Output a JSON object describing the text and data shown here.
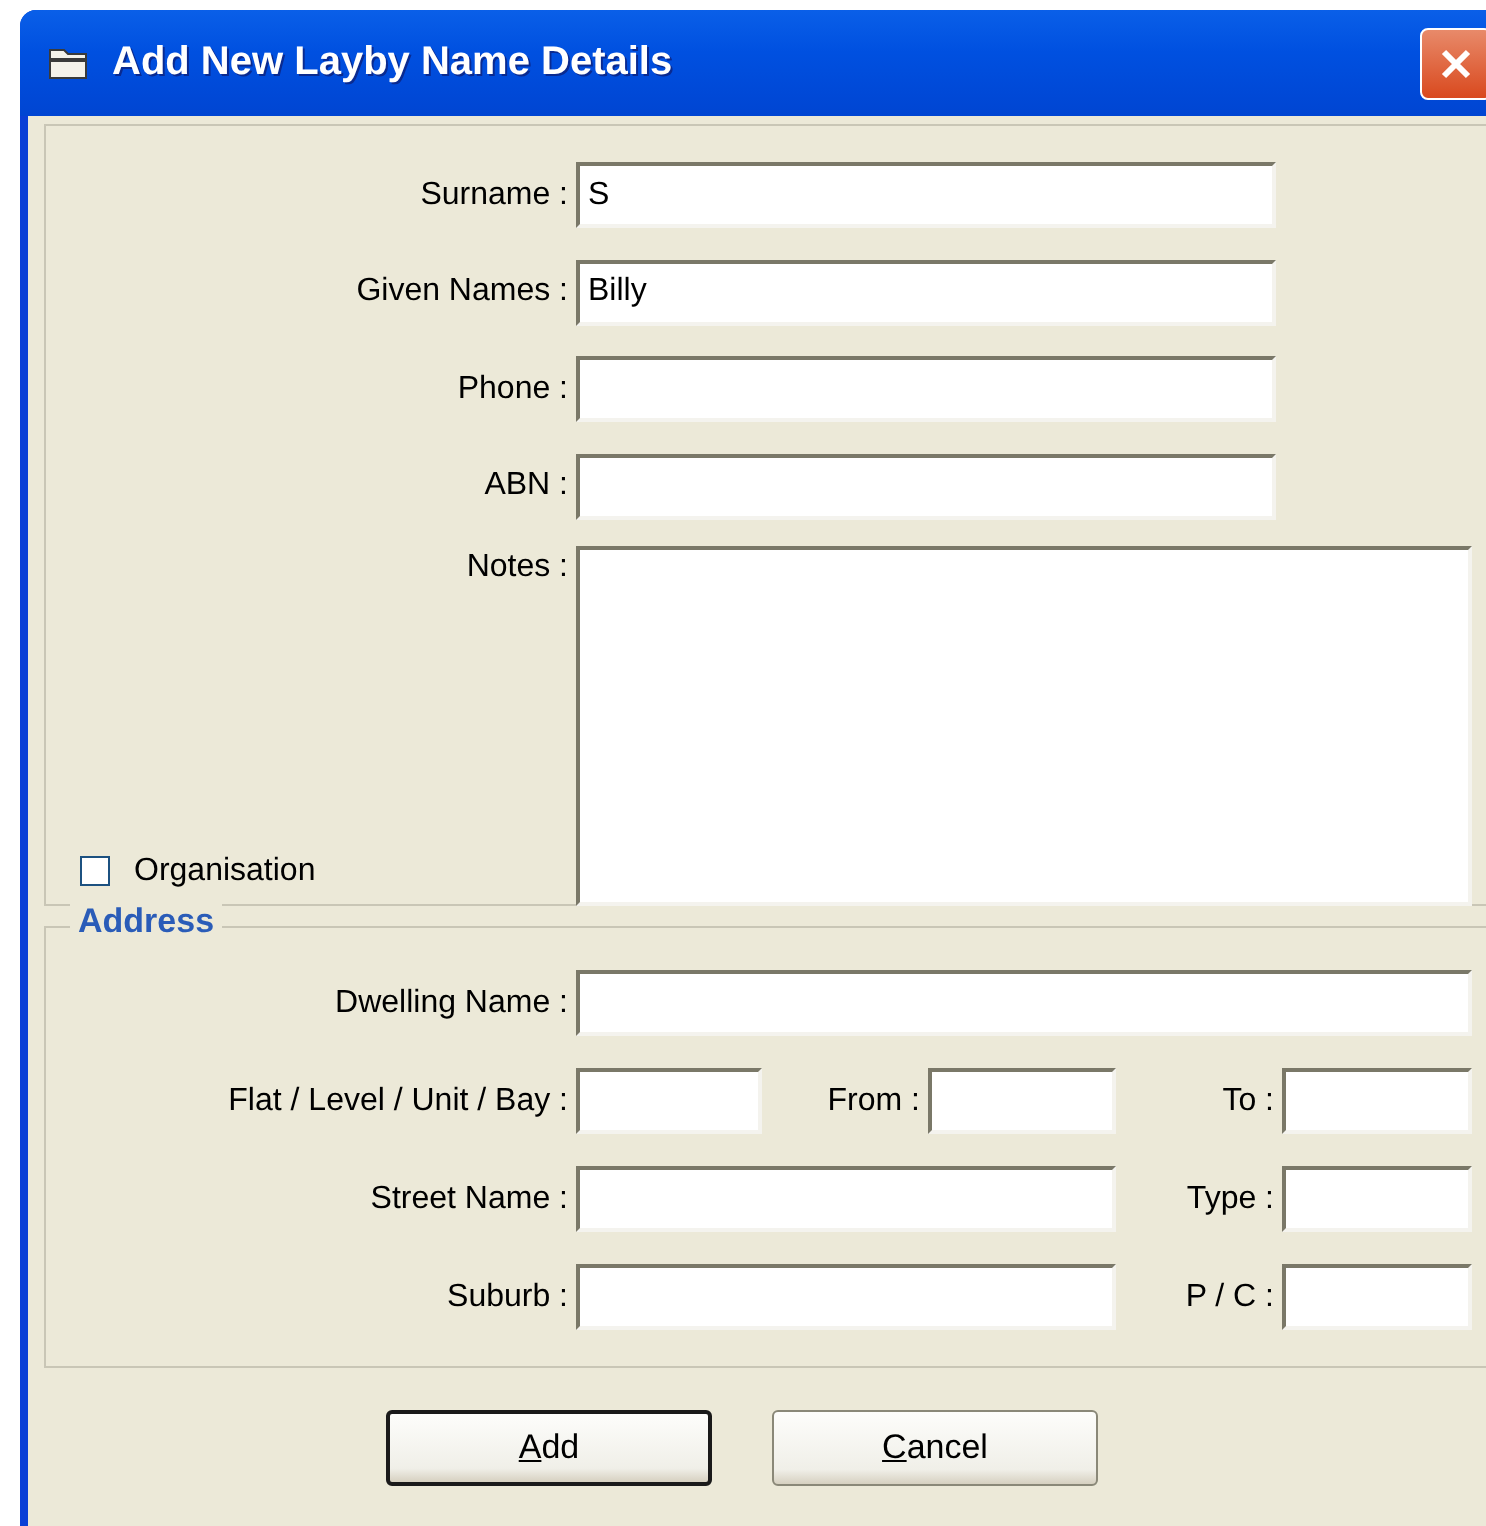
{
  "window": {
    "title": "Add New Layby Name Details"
  },
  "fields": [
    {
      "kind": "text",
      "label": "Surname :",
      "value": "S"
    },
    {
      "kind": "text",
      "label": "Given Names :",
      "value": "Billy"
    },
    {
      "kind": "text",
      "label": "Phone :"
    },
    {
      "kind": "text",
      "label": "ABN :"
    },
    {
      "kind": "notes",
      "label": "Notes :"
    }
  ],
  "organisation": {
    "label": "Organisation",
    "checked": false
  },
  "address": {
    "title": "Address",
    "rows": [
      {
        "fields": [
          {
            "label": "Dwelling Name :"
          }
        ]
      },
      {
        "fields": [
          {
            "label": "Flat / Level / Unit / Bay :"
          },
          {
            "label": "From :"
          },
          {
            "label": "To :"
          }
        ]
      },
      {
        "fields": [
          {
            "label": "Street Name :"
          },
          {
            "label": "Type :"
          }
        ]
      },
      {
        "fields": [
          {
            "label": "Suburb :"
          },
          {
            "label": "P / C :"
          }
        ]
      }
    ]
  },
  "buttons": [
    {
      "label": "Add",
      "default": true
    },
    {
      "label": "Cancel",
      "default": false
    }
  ]
}
